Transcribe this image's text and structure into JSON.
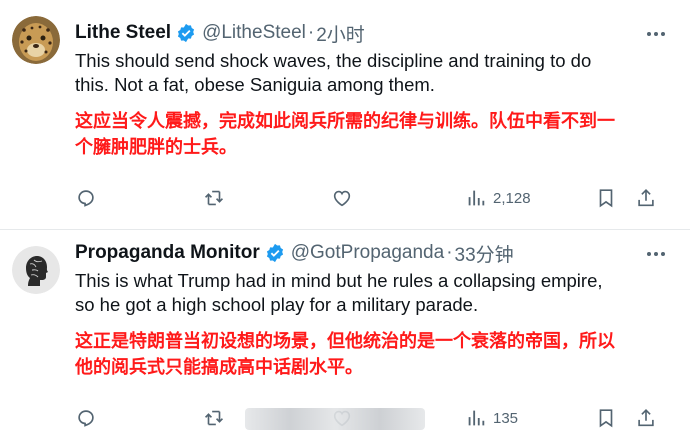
{
  "tweets": [
    {
      "author": "Lithe Steel",
      "handle": "@LitheSteel",
      "separator": "·",
      "time": "2小时",
      "text_lines": [
        "This should send shock waves, the discipline and training to do",
        "this. Not a fat, obese Saniguia among them."
      ],
      "translation_lines": [
        "这应当令人震撼，完成如此阅兵所需的纪律与训练。队伍中看不到一",
        "个臃肿肥胖的士兵。"
      ],
      "views": "2,128",
      "avatar": "leopard-avatar"
    },
    {
      "author": "Propaganda Monitor",
      "handle": "@GotPropaganda",
      "separator": "·",
      "time": "33分钟",
      "text_lines": [
        "This is what Trump had in mind but he rules a collapsing empire,",
        "so he got a high school play for a military parade."
      ],
      "translation_lines": [
        "这正是特朗普当初设想的场景，但他统治的是一个衰落的帝国，所以",
        "他的阅兵式只能搞成高中话剧水平。"
      ],
      "views": "135",
      "avatar": "head-silhouette-avatar"
    }
  ],
  "colors": {
    "verified": "#1d9bf0",
    "muted": "#536471",
    "translation": "#ff1a1a",
    "text": "#0f1419"
  },
  "icons": [
    "reply-icon",
    "retweet-icon",
    "like-icon",
    "views-icon",
    "bookmark-icon",
    "share-icon",
    "more-icon",
    "verified-icon"
  ]
}
